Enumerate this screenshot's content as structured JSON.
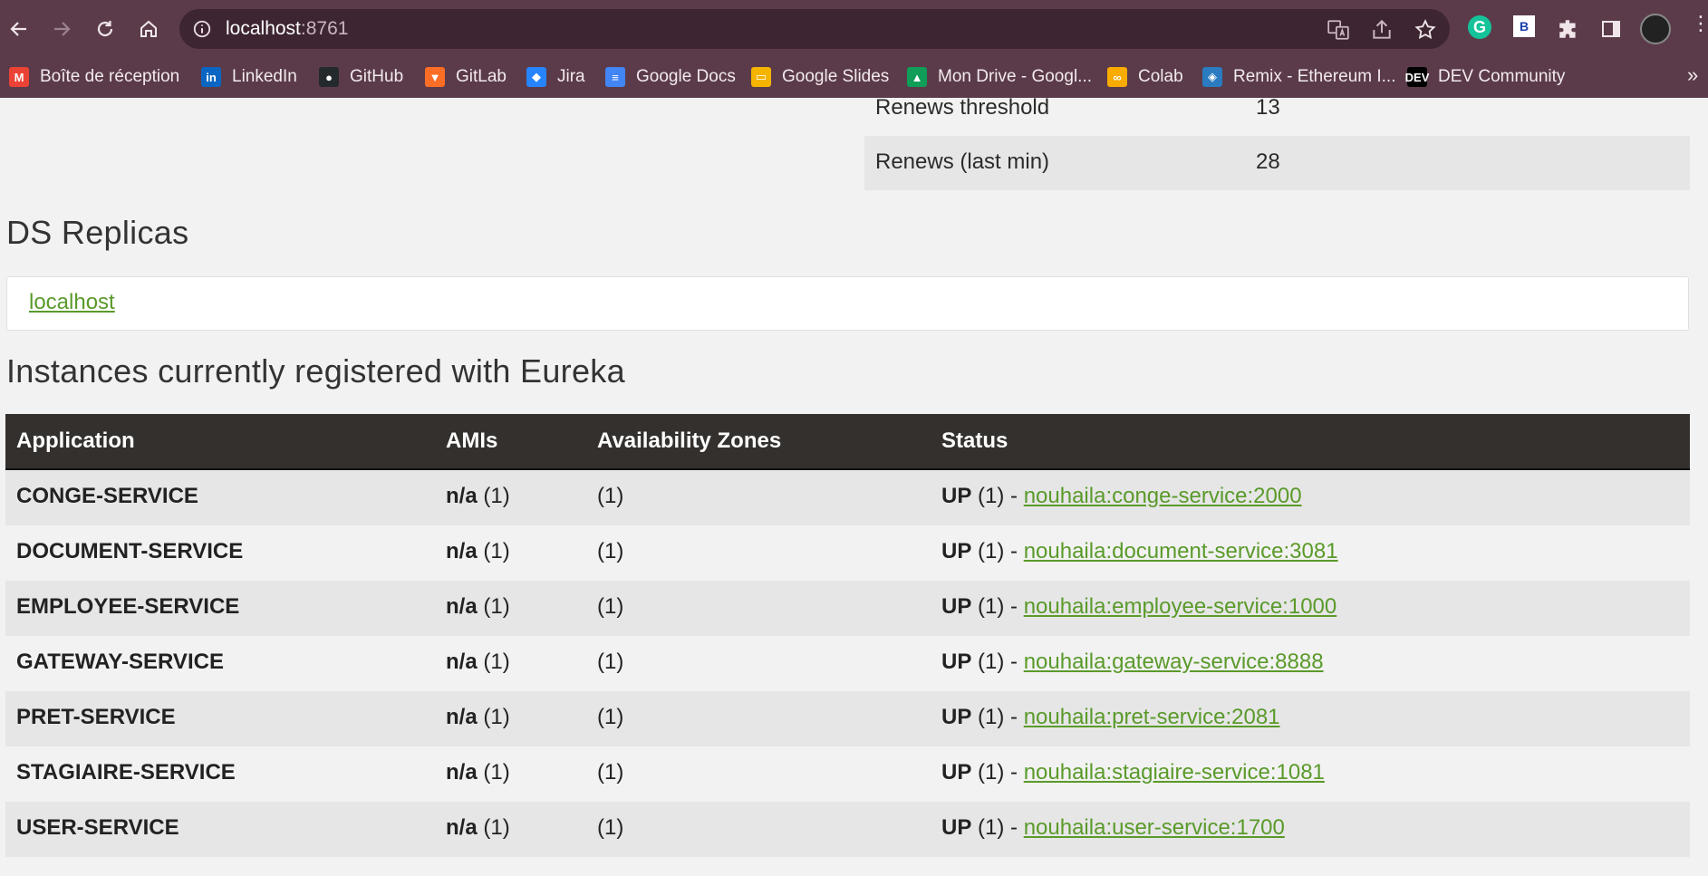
{
  "browser": {
    "url_host": "localhost",
    "url_port": ":8761",
    "bookmarks": [
      {
        "label": "Boîte de réception",
        "icon": "gmail-icon",
        "color": "#ea4335",
        "glyph": "M"
      },
      {
        "label": "LinkedIn",
        "icon": "linkedin-icon",
        "color": "#0a66c2",
        "glyph": "in"
      },
      {
        "label": "GitHub",
        "icon": "github-icon",
        "color": "#24292e",
        "glyph": "●"
      },
      {
        "label": "GitLab",
        "icon": "gitlab-icon",
        "color": "#fc6d26",
        "glyph": "▼"
      },
      {
        "label": "Jira",
        "icon": "jira-icon",
        "color": "#2684ff",
        "glyph": "◆"
      },
      {
        "label": "Google Docs",
        "icon": "google-docs-icon",
        "color": "#4285f4",
        "glyph": "≡"
      },
      {
        "label": "Google Slides",
        "icon": "google-slides-icon",
        "color": "#f4b400",
        "glyph": "▭"
      },
      {
        "label": "Mon Drive - Googl...",
        "icon": "google-drive-icon",
        "color": "#0f9d58",
        "glyph": "▲"
      },
      {
        "label": "Colab",
        "icon": "colab-icon",
        "color": "#f9ab00",
        "glyph": "∞"
      },
      {
        "label": "Remix - Ethereum I...",
        "icon": "remix-icon",
        "color": "#2a7bbf",
        "glyph": "◈"
      },
      {
        "label": "DEV Community",
        "icon": "dev-icon",
        "color": "#000000",
        "glyph": "DEV"
      }
    ],
    "more_glyph": "»"
  },
  "stats": [
    {
      "key": "Renews threshold",
      "value": "13"
    },
    {
      "key": "Renews (last min)",
      "value": "28"
    }
  ],
  "replicas": {
    "heading": "DS Replicas",
    "link": "localhost"
  },
  "instances": {
    "heading": "Instances currently registered with Eureka",
    "columns": [
      "Application",
      "AMIs",
      "Availability Zones",
      "Status"
    ],
    "rows": [
      {
        "app": "CONGE-SERVICE",
        "ami": "n/a",
        "ami_count": "(1)",
        "zones": "(1)",
        "status": "UP",
        "status_count": "(1) -",
        "link": "nouhaila:conge-service:2000"
      },
      {
        "app": "DOCUMENT-SERVICE",
        "ami": "n/a",
        "ami_count": "(1)",
        "zones": "(1)",
        "status": "UP",
        "status_count": "(1) -",
        "link": "nouhaila:document-service:3081"
      },
      {
        "app": "EMPLOYEE-SERVICE",
        "ami": "n/a",
        "ami_count": "(1)",
        "zones": "(1)",
        "status": "UP",
        "status_count": "(1) -",
        "link": "nouhaila:employee-service:1000"
      },
      {
        "app": "GATEWAY-SERVICE",
        "ami": "n/a",
        "ami_count": "(1)",
        "zones": "(1)",
        "status": "UP",
        "status_count": "(1) -",
        "link": "nouhaila:gateway-service:8888"
      },
      {
        "app": "PRET-SERVICE",
        "ami": "n/a",
        "ami_count": "(1)",
        "zones": "(1)",
        "status": "UP",
        "status_count": "(1) -",
        "link": "nouhaila:pret-service:2081"
      },
      {
        "app": "STAGIAIRE-SERVICE",
        "ami": "n/a",
        "ami_count": "(1)",
        "zones": "(1)",
        "status": "UP",
        "status_count": "(1) -",
        "link": "nouhaila:stagiaire-service:1081"
      },
      {
        "app": "USER-SERVICE",
        "ami": "n/a",
        "ami_count": "(1)",
        "zones": "(1)",
        "status": "UP",
        "status_count": "(1) -",
        "link": "nouhaila:user-service:1700"
      }
    ]
  }
}
